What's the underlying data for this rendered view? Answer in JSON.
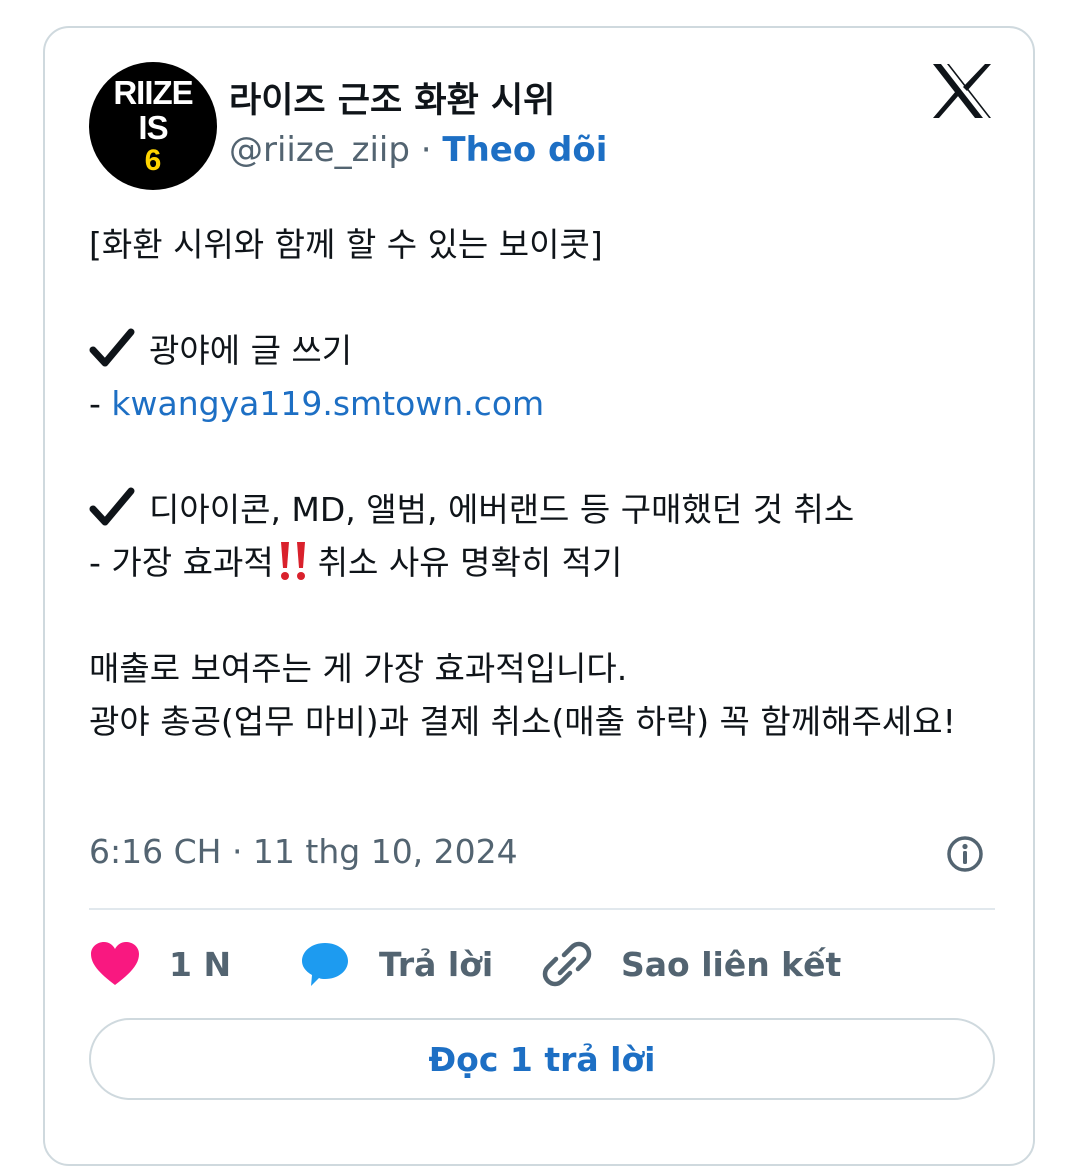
{
  "profile": {
    "avatar_line1": "RIIZE",
    "avatar_line2": "IS",
    "avatar_line3": "6",
    "display_name": "라이즈 근조 화환 시위",
    "handle": "@riize_ziip",
    "separator": " · ",
    "follow_label": "Theo dõi"
  },
  "tweet": {
    "line1": "[화환 시위와 함께 할 수 있는 보이콧]",
    "line2": "광야에 글 쓰기",
    "line3_prefix": "- ",
    "line3_link": "kwangya119.smtown.com",
    "line4": "디아이콘, MD, 앨범, 에버랜드 등 구매했던 것 취소",
    "line5_a": "- 가장 효과적",
    "line5_b": "취소 사유 명확히 적기",
    "line6": "매출로 보여주는 게 가장 효과적입니다.",
    "line7": "광야 총공(업무 마비)과 결제 취소(매출 하락) 꼭 함께해주세요!"
  },
  "timestamp": "6:16 CH · 11 thg 10, 2024",
  "actions": {
    "like_count": "1 N",
    "reply_label": "Trả lời",
    "copy_link_label": "Sao liên kết"
  },
  "read_replies_label": "Đọc 1 trả lời",
  "colors": {
    "accent": "#1d6fc4",
    "like": "#f91880",
    "reply": "#1d9bf0",
    "muted": "#536471",
    "border": "#cfd9de",
    "avatar_yellow": "#ffd400"
  },
  "icons": [
    "x-logo-icon",
    "check-mark-icon",
    "double-exclamation-icon",
    "info-icon",
    "heart-icon",
    "reply-bubble-icon",
    "link-icon"
  ]
}
